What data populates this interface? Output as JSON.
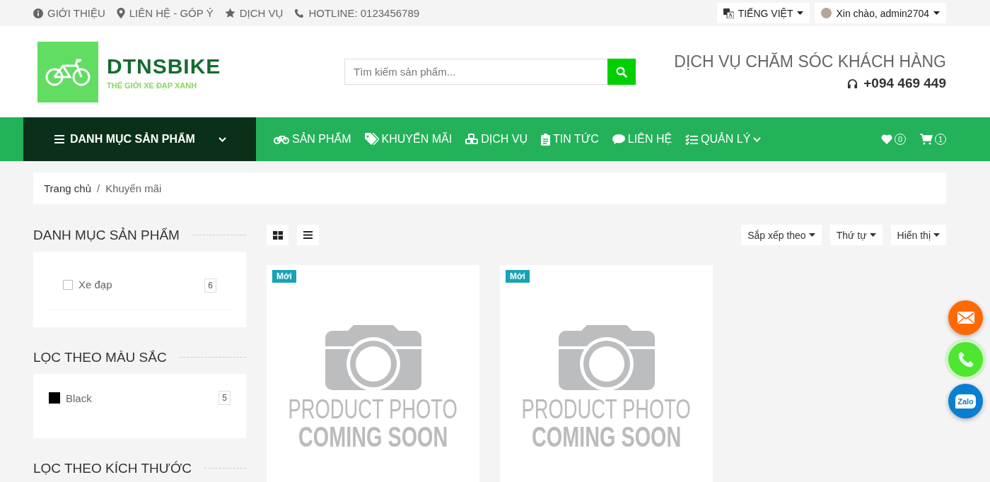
{
  "top_bar": {
    "links": [
      {
        "kind": "info",
        "label": "GIỚI THIỆU"
      },
      {
        "kind": "pin",
        "label": "LIÊN HỆ - GÓP Ý"
      },
      {
        "kind": "star",
        "label": "DỊCH VỤ"
      },
      {
        "kind": "phone",
        "label": "HOTLINE: 0123456789"
      }
    ],
    "language": "TIẾNG VIỆT",
    "user": "Xin chào, admin2704"
  },
  "header": {
    "logo": {
      "name": "DTNSBIKE",
      "tagline": "THẾ GIỚI XE ĐẠP XANH"
    },
    "search": {
      "placeholder": "Tìm kiếm sản phẩm..."
    },
    "support": {
      "title": "DỊCH VỤ CHĂM SÓC KHÁCH HÀNG",
      "phone": "+094 469 449"
    }
  },
  "nav": {
    "categories": "DANH MỤC SẢN PHẨM",
    "items": [
      {
        "kind": "bike",
        "label": "SẢN PHẨM",
        "dropdown": false
      },
      {
        "kind": "tag",
        "label": "KHUYẾN MÃI",
        "dropdown": false
      },
      {
        "kind": "cubes",
        "label": "DỊCH VỤ",
        "dropdown": false
      },
      {
        "kind": "clipboard",
        "label": "TIN TỨC",
        "dropdown": false
      },
      {
        "kind": "chat",
        "label": "LIÊN HỆ",
        "dropdown": false
      },
      {
        "kind": "tasks",
        "label": "QUẢN LÝ",
        "dropdown": true
      }
    ],
    "wishlist_count": "0",
    "cart_count": "1"
  },
  "breadcrumb": {
    "items": [
      "Trang chủ",
      "Khuyến mãi"
    ],
    "separator": "/"
  },
  "sidebar": {
    "sections": [
      {
        "kind": "category",
        "title": "DANH MỤC SẢN PHẨM",
        "items": [
          {
            "label": "Xe đạp",
            "count": "6",
            "checked": false
          }
        ]
      },
      {
        "kind": "color",
        "title": "LỌC THEO MÀU SẮC",
        "items": [
          {
            "label": "Black",
            "count": "5",
            "color": "#000000"
          }
        ]
      },
      {
        "kind": "heading",
        "title": "LỌC THEO KÍCH THƯỚC"
      }
    ]
  },
  "toolbar": {
    "views": [
      {
        "kind": "grid"
      },
      {
        "kind": "list"
      }
    ],
    "dropdowns": [
      "Sắp xếp theo",
      "Thứ tự",
      "Hiển thị"
    ]
  },
  "products": [
    {
      "badge": "Mới",
      "image_text": [
        "PRODUCT PHOTO",
        "COMING SOON"
      ]
    },
    {
      "badge": "Mới",
      "image_text": [
        "PRODUCT PHOTO",
        "COMING SOON"
      ]
    }
  ],
  "contact_buttons": [
    {
      "kind": "email"
    },
    {
      "kind": "phone"
    },
    {
      "kind": "zalo",
      "label": "Zalo"
    }
  ]
}
